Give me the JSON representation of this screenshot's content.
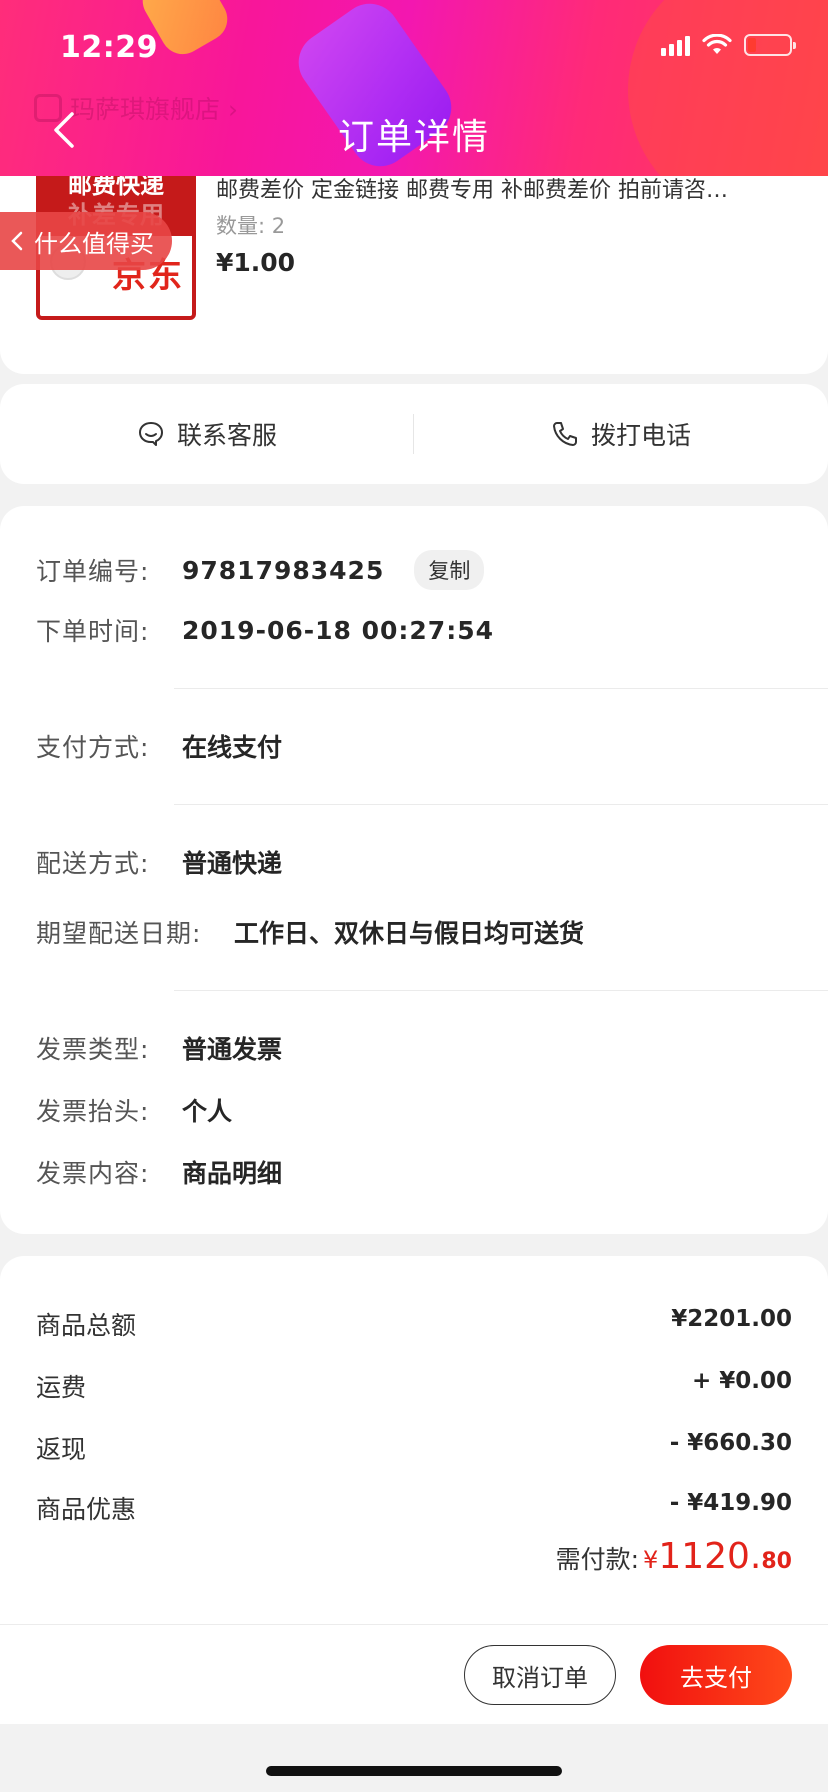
{
  "status_bar": {
    "time": "12:29"
  },
  "header": {
    "title": "订单详情",
    "ghost_store": "玛萨琪旗舰店 ›"
  },
  "float_tag": {
    "label": "什么值得买"
  },
  "product": {
    "thumb_line1": "邮费快递",
    "thumb_line2": "补差专用",
    "thumb_brand": "京东",
    "title": "邮费差价 定金链接 邮费专用 补邮费差价 拍前请咨…",
    "quantity": "数量: 2",
    "price": "¥1.00"
  },
  "contact": {
    "service_label": "联系客服",
    "phone_label": "拨打电话"
  },
  "order_info": {
    "order_no_label": "订单编号:",
    "order_no": "97817983425",
    "copy_label": "复制",
    "time_label": "下单时间:",
    "time": "2019-06-18 00:27:54",
    "pay_label": "支付方式:",
    "pay": "在线支付",
    "ship_label": "配送方式:",
    "ship": "普通快递",
    "expect_label": "期望配送日期:",
    "expect": "工作日、双休日与假日均可送货",
    "invoice_type_label": "发票类型:",
    "invoice_type": "普通发票",
    "invoice_title_label": "发票抬头:",
    "invoice_title": "个人",
    "invoice_content_label": "发票内容:",
    "invoice_content": "商品明细"
  },
  "amounts": {
    "items": [
      {
        "label": "商品总额",
        "value": "¥2201.00"
      },
      {
        "label": "运费",
        "value": "+ ¥0.00"
      },
      {
        "label": "返现",
        "value": "- ¥660.30"
      },
      {
        "label": "商品优惠",
        "value": "- ¥419.90"
      }
    ],
    "need_pay_label": "需付款:",
    "need_pay_currency": "¥",
    "need_pay_int": "1120.",
    "need_pay_dec": "80"
  },
  "actions": {
    "cancel_label": "取消订单",
    "pay_label": "去支付"
  },
  "colors": {
    "accent": "#e2231a",
    "header_pink": "#f317b0",
    "pay_button": "#f10f0f"
  }
}
